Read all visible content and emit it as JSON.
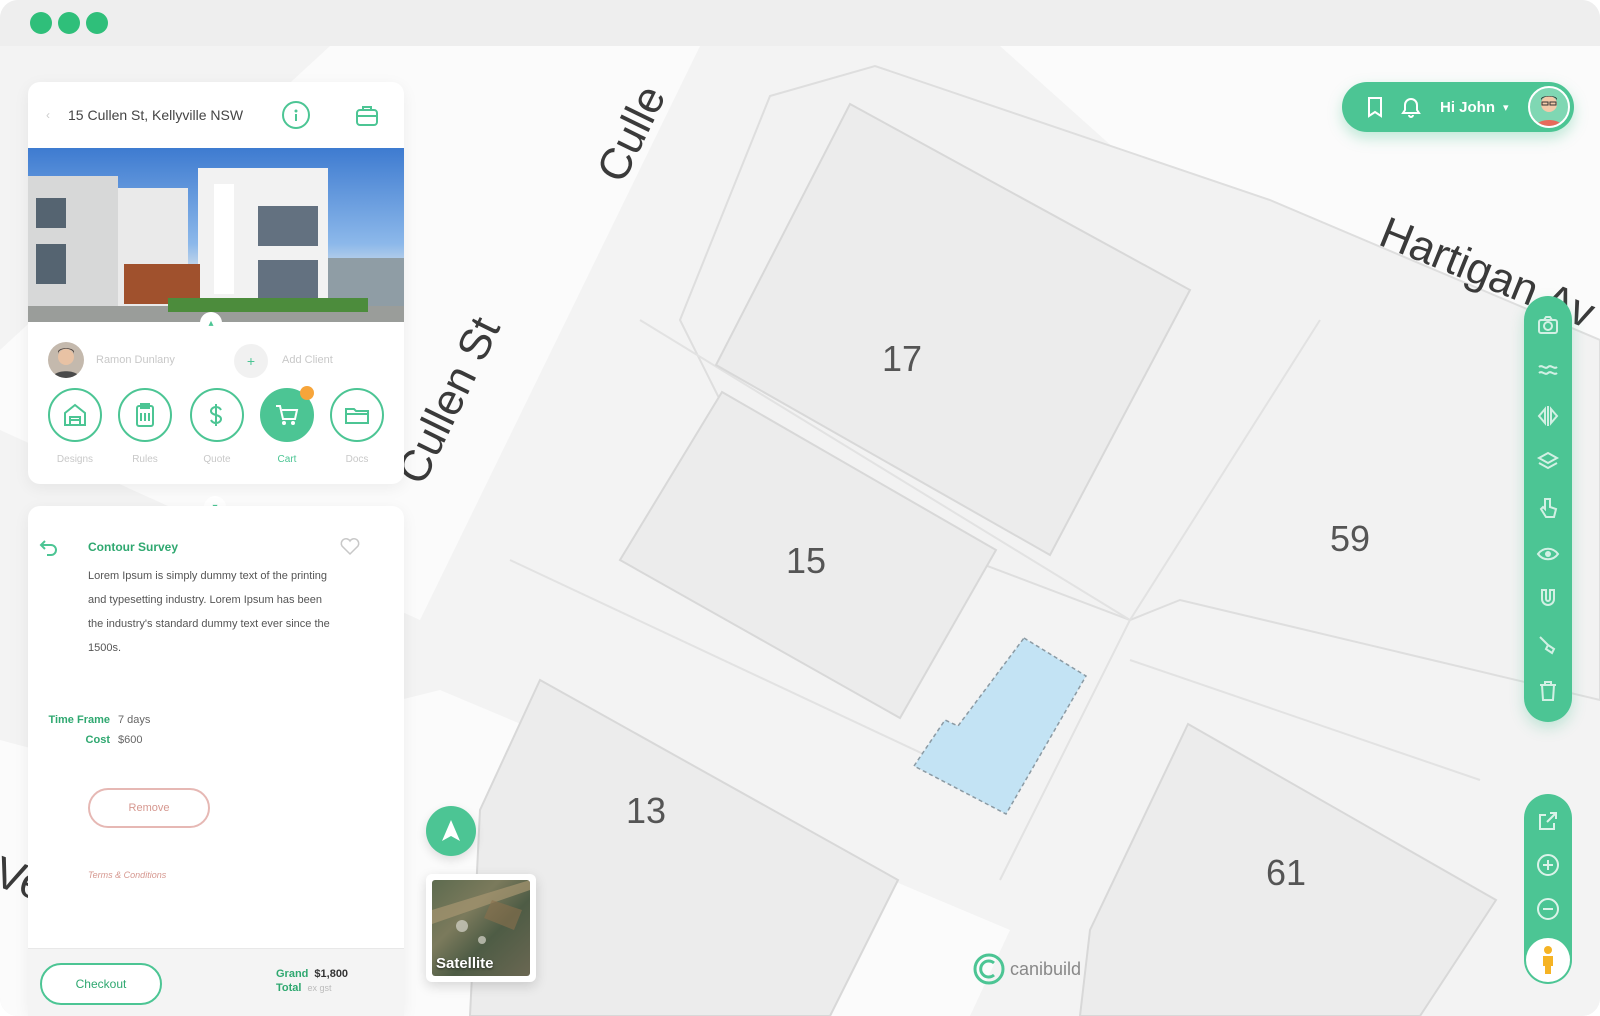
{
  "window": {
    "accent": "#4cc594"
  },
  "map": {
    "streets": [
      {
        "id": "cullen-st",
        "label": "Cullen St"
      },
      {
        "id": "cullen-st-top",
        "label": "Culle"
      },
      {
        "id": "hartigan-av",
        "label": "Hartigan Av"
      },
      {
        "id": "left-edge",
        "label": "Ve"
      }
    ],
    "lots": [
      "17",
      "15",
      "59",
      "13",
      "61"
    ],
    "selected_lot_color": "#c3e3f4",
    "satellite_label": "Satellite",
    "brand": "canibuild"
  },
  "user": {
    "greeting": "Hi John",
    "icons": [
      "bookmark-icon",
      "bell-icon"
    ]
  },
  "toolbar": {
    "tools": [
      "camera-icon",
      "waves-icon",
      "mirror-icon",
      "layers-icon",
      "pointer-icon",
      "eye-icon",
      "magnet-icon",
      "brush-icon",
      "trash-icon"
    ],
    "zoom": [
      "share-icon",
      "zoom-in-icon",
      "zoom-out-icon",
      "pegman-icon"
    ]
  },
  "property": {
    "address": "15 Cullen St, Kellyville NSW",
    "agent": "Ramon Dunlany",
    "add_client": "Add Client",
    "actions": [
      {
        "label": "Designs",
        "icon": "house-icon"
      },
      {
        "label": "Rules",
        "icon": "clipboard-icon"
      },
      {
        "label": "Quote",
        "icon": "dollar-icon"
      },
      {
        "label": "Cart",
        "icon": "cart-icon",
        "active": true
      },
      {
        "label": "Docs",
        "icon": "folder-icon"
      }
    ]
  },
  "service": {
    "title": "Contour Survey",
    "description": "Lorem Ipsum is simply dummy text of the printing and typesetting industry. Lorem Ipsum has been the industry's standard dummy text ever since the 1500s.",
    "time_frame_label": "Time Frame",
    "time_frame_value": "7 days",
    "cost_label": "Cost",
    "cost_value": "$600",
    "remove_label": "Remove",
    "terms_label": "Terms & Conditions"
  },
  "footer": {
    "checkout_label": "Checkout",
    "grand_label": "Grand",
    "total_label": "Total",
    "total_value": "$1,800",
    "tax_note": "ex gst"
  }
}
